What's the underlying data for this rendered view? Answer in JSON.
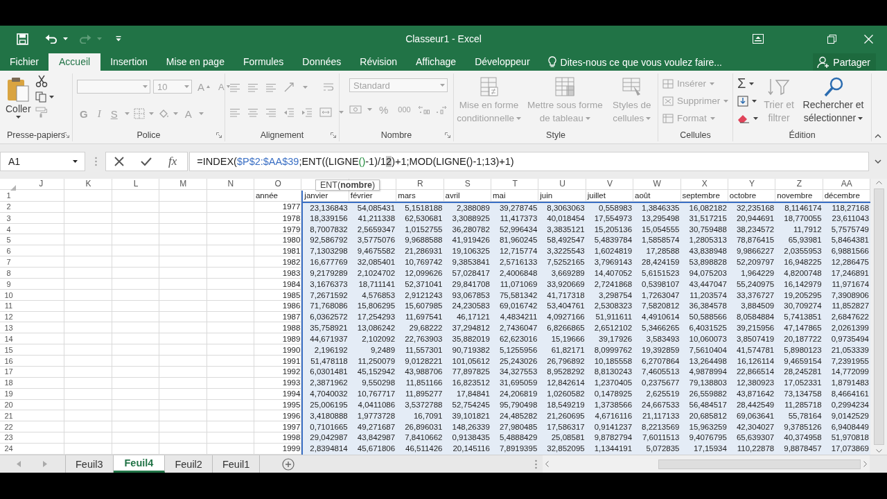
{
  "title_bar": {
    "title": "Classeur1 - Excel"
  },
  "menu_tabs": [
    {
      "label": "Fichier",
      "selected": false
    },
    {
      "label": "Accueil",
      "selected": true
    },
    {
      "label": "Insertion",
      "selected": false
    },
    {
      "label": "Mise en page",
      "selected": false
    },
    {
      "label": "Formules",
      "selected": false
    },
    {
      "label": "Données",
      "selected": false
    },
    {
      "label": "Révision",
      "selected": false
    },
    {
      "label": "Affichage",
      "selected": false
    },
    {
      "label": "Développeur",
      "selected": false
    }
  ],
  "tell_me": "Dites-nous ce que vous voulez faire...",
  "share": "Partager",
  "ribbon": {
    "groups": [
      {
        "kind": "clipboard",
        "label": "Presse-papiers",
        "launcher": true,
        "disabled": false,
        "paste": "Coller"
      },
      {
        "kind": "font",
        "label": "Police",
        "launcher": true,
        "disabled": true,
        "font_size": "10",
        "grow": "A",
        "shrink": "A",
        "bold": "G",
        "italic": "I",
        "underline": "S",
        "font_color": "A"
      },
      {
        "kind": "alignment",
        "label": "Alignement",
        "launcher": true,
        "disabled": true
      },
      {
        "kind": "number",
        "label": "Nombre",
        "launcher": true,
        "disabled": true,
        "format": "Standard",
        "percent": "%",
        "thousands": "000"
      },
      {
        "kind": "styles",
        "label": "Style",
        "launcher": false,
        "disabled": true,
        "buttons": [
          "Mise en forme conditionnelle",
          "Mettre sous forme de tableau",
          "Styles de cellules"
        ]
      },
      {
        "kind": "cells",
        "label": "Cellules",
        "launcher": false,
        "disabled": true,
        "buttons": [
          "Insérer",
          "Supprimer",
          "Format"
        ]
      },
      {
        "kind": "editing",
        "label": "Édition",
        "launcher": false,
        "disabled": false,
        "autosum": "Σ",
        "buttons": [
          {
            "label": "Trier et filtrer",
            "disabled": true
          },
          {
            "label": "Rechercher et sélectionner",
            "disabled": false
          }
        ]
      }
    ]
  },
  "formula_bar": {
    "name_box": "A1",
    "fx": "fx",
    "formula": [
      {
        "kind": "text",
        "text": "=INDEX("
      },
      {
        "kind": "range",
        "text": "$P$2:$AA$39"
      },
      {
        "kind": "text",
        "text": ";ENT((LIGNE"
      },
      {
        "kind": "paren",
        "text": "()"
      },
      {
        "kind": "text",
        "text": "-1)/1"
      },
      {
        "kind": "selected",
        "text": "2"
      },
      {
        "kind": "text",
        "text": ")+1;MOD(LIGNE()-1;13)+1)"
      }
    ]
  },
  "sheet": {
    "columns": [
      {
        "kind": "letter",
        "letter": "J"
      },
      {
        "kind": "letter",
        "letter": "K"
      },
      {
        "kind": "letter",
        "letter": "L"
      },
      {
        "kind": "letter",
        "letter": "M"
      },
      {
        "kind": "letter",
        "letter": "N"
      },
      {
        "kind": "letter",
        "letter": "O"
      },
      {
        "kind": "covered"
      },
      {
        "kind": "covered"
      },
      {
        "kind": "letter",
        "letter": "R"
      },
      {
        "kind": "letter",
        "letter": "S"
      },
      {
        "kind": "letter",
        "letter": "T"
      },
      {
        "kind": "letter",
        "letter": "U"
      },
      {
        "kind": "letter",
        "letter": "V"
      },
      {
        "kind": "letter",
        "letter": "W"
      },
      {
        "kind": "letter",
        "letter": "X"
      },
      {
        "kind": "letter",
        "letter": "Y"
      },
      {
        "kind": "letter",
        "letter": "Z"
      },
      {
        "kind": "letter",
        "letter": "AA"
      }
    ],
    "tooltip": "ENT(**nombre**)",
    "range_highlight": true,
    "header_row": {
      "number": "1",
      "label": "année",
      "months": [
        "janvier",
        "février",
        "mars",
        "avril",
        "mai",
        "juin",
        "juillet",
        "août",
        "septembre",
        "octobre",
        "novembre",
        "décembre"
      ]
    },
    "rows": [
      {
        "number": "2",
        "year": "1977",
        "values": [
          "23,136843",
          "54,085431",
          "5,1518188",
          "2,388089",
          "39,278745",
          "8,3063063",
          "0,558983",
          "1,3846335",
          "16,082182",
          "32,235168",
          "8,1146174",
          "118,27168"
        ]
      },
      {
        "number": "3",
        "year": "1978",
        "values": [
          "18,339156",
          "41,211338",
          "62,530681",
          "3,3088925",
          "11,417373",
          "40,018454",
          "17,554973",
          "13,295498",
          "31,517215",
          "20,944691",
          "18,770055",
          "23,611043"
        ]
      },
      {
        "number": "4",
        "year": "1979",
        "values": [
          "8,7007832",
          "2,5659347",
          "1,0152755",
          "36,280782",
          "52,996434",
          "3,3835121",
          "15,205136",
          "15,054555",
          "30,759488",
          "38,234572",
          "11,7912",
          "5,7575749"
        ]
      },
      {
        "number": "5",
        "year": "1980",
        "values": [
          "92,586792",
          "3,5775076",
          "9,9688588",
          "41,919426",
          "81,960245",
          "58,492547",
          "5,4839784",
          "1,5858574",
          "1,2805313",
          "78,876415",
          "65,93981",
          "5,8464381"
        ]
      },
      {
        "number": "6",
        "year": "1981",
        "values": [
          "7,1303298",
          "9,4675582",
          "21,286931",
          "19,106325",
          "12,715774",
          "3,3225543",
          "1,6024819",
          "17,28588",
          "43,838948",
          "9,9866227",
          "2,0355953",
          "6,9881566"
        ]
      },
      {
        "number": "7",
        "year": "1982",
        "values": [
          "16,677769",
          "32,085401",
          "10,769742",
          "9,3853841",
          "2,5716133",
          "7,5252165",
          "3,7969143",
          "28,424159",
          "53,898828",
          "52,209797",
          "16,948225",
          "12,286475"
        ]
      },
      {
        "number": "8",
        "year": "1983",
        "values": [
          "9,2179289",
          "2,1024702",
          "12,099626",
          "57,028417",
          "2,4006848",
          "3,669289",
          "14,407052",
          "5,6151523",
          "94,075203",
          "1,964229",
          "4,8200748",
          "17,246891"
        ]
      },
      {
        "number": "9",
        "year": "1984",
        "values": [
          "3,1676373",
          "18,711141",
          "52,371041",
          "29,841708",
          "11,071069",
          "33,920669",
          "2,7241868",
          "0,5398107",
          "43,447047",
          "55,240975",
          "16,142979",
          "11,971674"
        ]
      },
      {
        "number": "10",
        "year": "1985",
        "values": [
          "7,2671592",
          "4,576853",
          "2,9121243",
          "93,067853",
          "75,581342",
          "41,717318",
          "3,298754",
          "1,7263047",
          "11,203574",
          "33,376727",
          "19,205295",
          "7,3908906"
        ]
      },
      {
        "number": "11",
        "year": "1986",
        "values": [
          "71,768086",
          "15,806295",
          "15,607985",
          "24,230583",
          "69,016742",
          "53,404761",
          "2,5308323",
          "7,5820812",
          "36,384578",
          "3,884509",
          "30,709274",
          "11,852827"
        ]
      },
      {
        "number": "12",
        "year": "1987",
        "values": [
          "6,0362572",
          "17,254293",
          "11,697541",
          "46,17121",
          "4,4834211",
          "4,0927166",
          "51,911611",
          "4,4910614",
          "50,588566",
          "8,0584884",
          "5,7413851",
          "2,6847622"
        ]
      },
      {
        "number": "13",
        "year": "1988",
        "values": [
          "35,758921",
          "13,086242",
          "29,68222",
          "37,294812",
          "2,7436047",
          "6,8266865",
          "2,6512102",
          "5,3466265",
          "6,4031525",
          "39,215956",
          "47,147865",
          "2,0261399"
        ]
      },
      {
        "number": "14",
        "year": "1989",
        "values": [
          "44,671937",
          "2,102092",
          "22,763903",
          "35,882019",
          "62,623016",
          "15,19666",
          "39,17926",
          "3,583493",
          "10,060073",
          "3,8507419",
          "20,187722",
          "0,9735494"
        ]
      },
      {
        "number": "15",
        "year": "1990",
        "values": [
          "2,196192",
          "9,2489",
          "11,557301",
          "90,719382",
          "5,1255956",
          "61,82171",
          "8,0999762",
          "19,392859",
          "7,5610404",
          "41,574781",
          "5,8980123",
          "21,053339"
        ]
      },
      {
        "number": "16",
        "year": "1991",
        "values": [
          "51,478118",
          "11,250079",
          "9,0128221",
          "101,05612",
          "25,243026",
          "26,796892",
          "10,185558",
          "6,2707864",
          "13,264498",
          "16,126114",
          "9,4659154",
          "7,2391955"
        ]
      },
      {
        "number": "17",
        "year": "1992",
        "values": [
          "6,0301481",
          "45,152942",
          "43,988706",
          "77,897825",
          "34,327553",
          "8,9528292",
          "8,8130243",
          "7,4605513",
          "4,9878994",
          "22,866514",
          "28,245281",
          "14,772099"
        ]
      },
      {
        "number": "18",
        "year": "1993",
        "values": [
          "2,3871962",
          "9,550298",
          "11,851166",
          "16,823512",
          "31,695059",
          "12,842614",
          "1,2370405",
          "0,2375677",
          "79,138803",
          "12,380923",
          "17,052331",
          "1,8791483"
        ]
      },
      {
        "number": "19",
        "year": "1994",
        "values": [
          "4,7040032",
          "10,767717",
          "11,895277",
          "17,84841",
          "24,206819",
          "1,0260582",
          "0,1478925",
          "2,625519",
          "26,559882",
          "43,871642",
          "73,134758",
          "8,4664161"
        ]
      },
      {
        "number": "20",
        "year": "1995",
        "values": [
          "25,006195",
          "4,0411086",
          "3,5372788",
          "52,754245",
          "95,790498",
          "18,549219",
          "1,3738566",
          "24,667533",
          "56,484517",
          "28,442549",
          "11,285718",
          "0,2994234"
        ]
      },
      {
        "number": "21",
        "year": "1996",
        "values": [
          "3,4180888",
          "1,9773728",
          "16,7091",
          "39,101821",
          "24,485282",
          "21,260695",
          "4,6716116",
          "21,117133",
          "20,685812",
          "69,063641",
          "55,78164",
          "9,0142529"
        ]
      },
      {
        "number": "22",
        "year": "1997",
        "values": [
          "0,7101665",
          "49,271687",
          "26,896031",
          "148,26339",
          "27,980485",
          "17,586317",
          "0,9141237",
          "8,2213569",
          "15,963259",
          "42,304027",
          "9,3785126",
          "6,9408449"
        ]
      },
      {
        "number": "23",
        "year": "1998",
        "values": [
          "29,042987",
          "43,842987",
          "7,8410662",
          "0,9138435",
          "5,4888429",
          "25,08581",
          "9,8782794",
          "7,6011513",
          "9,4076795",
          "65,639307",
          "40,374958",
          "51,970818"
        ]
      },
      {
        "number": "24",
        "year": "1999",
        "values": [
          "2,8394814",
          "45,671806",
          "46,511426",
          "20,145116",
          "7,8919395",
          "32,852095",
          "1,1344191",
          "5,072835",
          "17,15934",
          "110,22878",
          "9,8878457",
          "17,073869"
        ]
      }
    ]
  },
  "sheet_tabs": [
    {
      "label": "Feuil3",
      "selected": false
    },
    {
      "label": "Feuil4",
      "selected": true
    },
    {
      "label": "Feuil2",
      "selected": false
    },
    {
      "label": "Feuil1",
      "selected": false
    }
  ]
}
